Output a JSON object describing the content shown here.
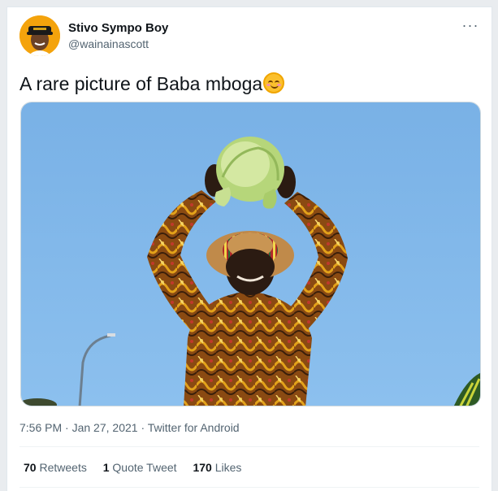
{
  "author": {
    "display_name": "Stivo Sympo Boy",
    "handle": "@wainainascott"
  },
  "more_menu_label": "···",
  "tweet": {
    "text": "A rare picture of Baba mboga",
    "emoji": "smiling-face-with-smiling-eyes"
  },
  "meta": {
    "time": "7:56 PM",
    "sep1": " · ",
    "date": "Jan 27, 2021",
    "sep2": " · ",
    "source": "Twitter for Android"
  },
  "stats": {
    "retweets_count": "70",
    "retweets_label": "Retweets",
    "quotes_count": "1",
    "quotes_label": "Quote Tweet",
    "likes_count": "170",
    "likes_label": "Likes"
  },
  "colors": {
    "sky": "#7fb3e6",
    "text_primary": "#0f1419",
    "text_secondary": "#536471",
    "avatar_bg": "#f4a30c"
  }
}
